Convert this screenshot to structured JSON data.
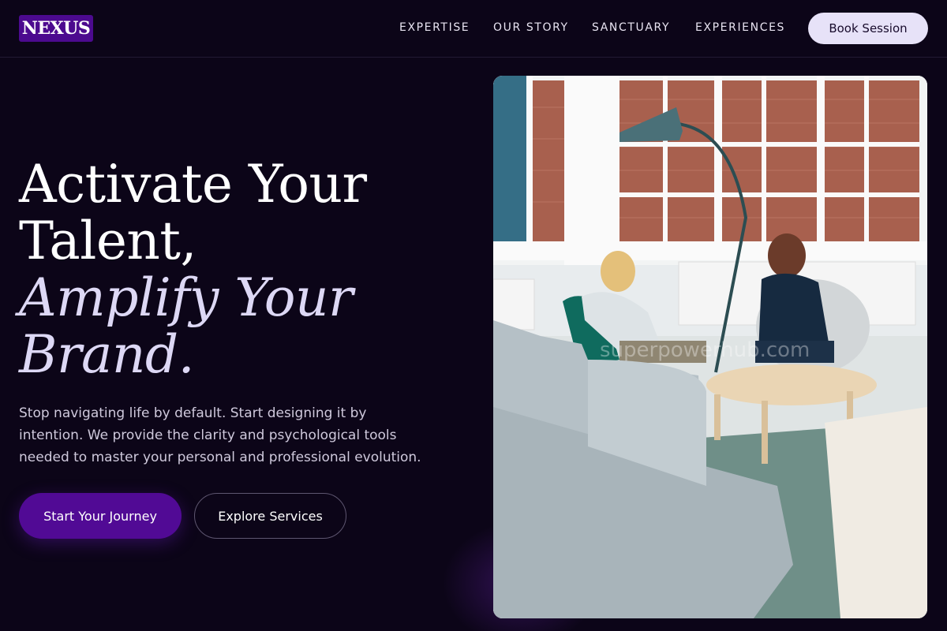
{
  "header": {
    "logo_text": "NEXUS",
    "nav": [
      {
        "label": "EXPERTISE"
      },
      {
        "label": "OUR STORY"
      },
      {
        "label": "SANCTUARY"
      },
      {
        "label": "EXPERIENCES"
      }
    ],
    "cta_label": "Book Session"
  },
  "hero": {
    "headline_line1": "Activate Your",
    "headline_line2": "Talent,",
    "headline_line3": "Amplify Your",
    "headline_line4": "Brand.",
    "subtext": "Stop navigating life by default. Start designing it by intention. We provide the clarity and psychological tools needed to master your personal and professional evolution.",
    "primary_button": "Start Your Journey",
    "secondary_button": "Explore Services",
    "image_watermark": "superpowerhub.com"
  },
  "colors": {
    "background": "#0c0518",
    "accent": "#510a95",
    "logo_bg": "#4c0a8f",
    "book_button_bg": "#e7e2f8"
  }
}
